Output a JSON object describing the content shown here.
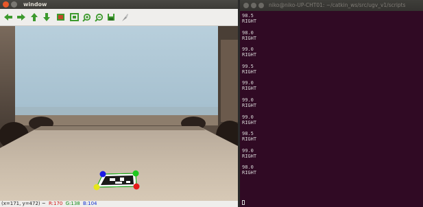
{
  "image_window": {
    "title": "window",
    "toolbar": [
      {
        "icon": "arrow-left-icon",
        "color": "#3d9a2e"
      },
      {
        "icon": "arrow-right-icon",
        "color": "#3d9a2e"
      },
      {
        "icon": "arrow-up-icon",
        "color": "#3d9a2e"
      },
      {
        "icon": "arrow-down-icon",
        "color": "#3d9a2e"
      },
      {
        "icon": "image-icon",
        "color": "#3d9a2e"
      },
      {
        "icon": "zoom-fit-icon",
        "color": "#3d9a2e"
      },
      {
        "icon": "zoom-in-icon",
        "color": "#3d9a2e"
      },
      {
        "icon": "zoom-out-icon",
        "color": "#3d9a2e"
      },
      {
        "icon": "save-icon",
        "color": "#3d9a2e"
      },
      {
        "icon": "properties-icon",
        "color": "#8a8a8a"
      }
    ],
    "status": {
      "coords": "(x=171, y=472) ~",
      "r": "R:170",
      "g": "G:138",
      "b": "B:104"
    },
    "marker_corners": [
      {
        "name": "blue",
        "color": "#1a1ae6"
      },
      {
        "name": "green",
        "color": "#1ec81e"
      },
      {
        "name": "yellow",
        "color": "#e6e61a"
      },
      {
        "name": "red",
        "color": "#e61a1a"
      }
    ]
  },
  "terminal": {
    "title": "niko@niko-UP-CHT01: ~/catkin_ws/src/ugv_v1/scripts",
    "lines": [
      {
        "value": "98.5",
        "direction": "RIGHT"
      },
      {
        "value": "98.0",
        "direction": "RIGHT"
      },
      {
        "value": "99.0",
        "direction": "RIGHT"
      },
      {
        "value": "99.5",
        "direction": "RIGHT"
      },
      {
        "value": "99.0",
        "direction": "RIGHT"
      },
      {
        "value": "99.0",
        "direction": "RIGHT"
      },
      {
        "value": "99.0",
        "direction": "RIGHT"
      },
      {
        "value": "98.5",
        "direction": "RIGHT"
      },
      {
        "value": "99.0",
        "direction": "RIGHT"
      },
      {
        "value": "98.0",
        "direction": "RIGHT"
      }
    ]
  }
}
